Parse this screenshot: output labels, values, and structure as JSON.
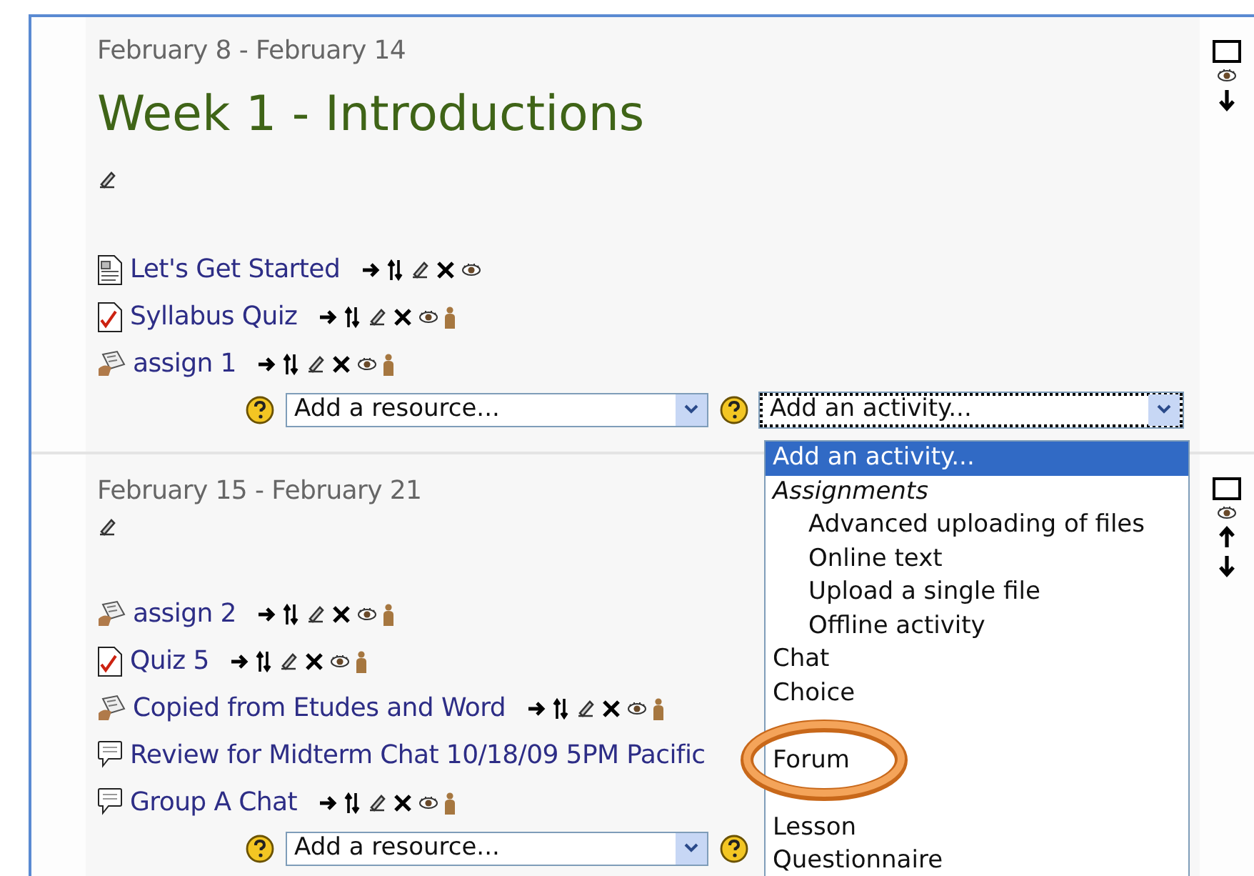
{
  "sections": [
    {
      "date": "February 8 - February 14",
      "title": "Week 1 - Introductions",
      "activities": [
        {
          "kind": "page",
          "name": "Let's Get Started",
          "controls": true,
          "group_mode": false
        },
        {
          "kind": "quiz",
          "name": "Syllabus Quiz",
          "controls": true,
          "group_mode": true
        },
        {
          "kind": "assignment",
          "name": "assign 1",
          "controls": true,
          "group_mode": true
        }
      ],
      "resource_select": "Add a resource...",
      "activity_select": "Add an activity...",
      "activity_focused": true,
      "side_controls": [
        {
          "kind": "highlight"
        },
        {
          "kind": "show"
        },
        {
          "kind": "down"
        }
      ]
    },
    {
      "date": "February 15 - February 21",
      "activities": [
        {
          "kind": "assignment",
          "name": "assign 2",
          "controls": true,
          "group_mode": true
        },
        {
          "kind": "quiz",
          "name": "Quiz 5",
          "controls": true,
          "group_mode": true
        },
        {
          "kind": "assignment",
          "name": "Copied from Etudes and Word",
          "controls": true,
          "group_mode": true
        },
        {
          "kind": "chat",
          "name": "Review for Midterm Chat 10/18/09 5PM Pacific",
          "controls": false,
          "group_mode": false
        },
        {
          "kind": "chat",
          "name": "Group A Chat",
          "controls": true,
          "group_mode": true
        }
      ],
      "resource_select": "Add a resource...",
      "side_controls": [
        {
          "kind": "highlight"
        },
        {
          "kind": "show"
        },
        {
          "kind": "up"
        },
        {
          "kind": "down"
        }
      ]
    }
  ],
  "activity_dropdown": {
    "options": [
      {
        "kind": "option",
        "label": "Add an activity...",
        "selected": true
      },
      {
        "kind": "group",
        "label": "Assignments",
        "children": [
          {
            "kind": "option",
            "label": "Advanced uploading of files",
            "selected": false
          },
          {
            "kind": "option",
            "label": "Online text",
            "selected": false
          },
          {
            "kind": "option",
            "label": "Upload a single file",
            "selected": false
          },
          {
            "kind": "option",
            "label": "Offline activity",
            "selected": false
          }
        ]
      },
      {
        "kind": "option",
        "label": "Chat",
        "selected": false
      },
      {
        "kind": "option",
        "label": "Choice",
        "selected": false
      },
      {
        "kind": "covered"
      },
      {
        "kind": "option",
        "label": "Forum",
        "selected": false
      },
      {
        "kind": "covered"
      },
      {
        "kind": "option",
        "label": "Lesson",
        "selected": false
      },
      {
        "kind": "option",
        "label": "Questionnaire",
        "selected": false
      }
    ],
    "highlight_ring": true
  }
}
